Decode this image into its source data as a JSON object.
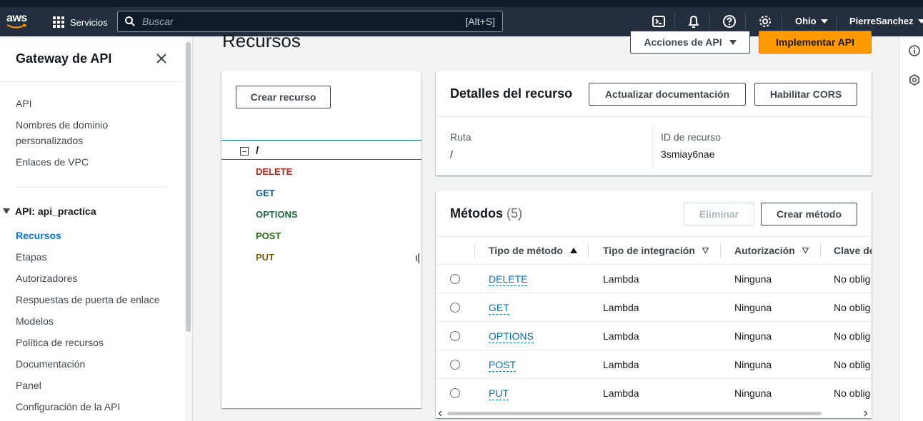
{
  "topbar": {
    "logo": "aws",
    "services_label": "Servicios",
    "search_placeholder": "Buscar",
    "search_shortcut": "[Alt+S]",
    "icons": [
      "cloudshell-icon",
      "bell-icon",
      "help-icon",
      "gear-icon"
    ],
    "region": "Ohio",
    "user": "PierreSanchez"
  },
  "sidebar": {
    "title": "Gateway de API",
    "top_links": [
      "API",
      "Nombres de dominio personalizados",
      "Enlaces de VPC"
    ],
    "section_title": "API: api_practica",
    "section_links": [
      "Recursos",
      "Etapas",
      "Autorizadores",
      "Respuestas de puerta de enlace",
      "Modelos",
      "Política de recursos",
      "Documentación",
      "Panel",
      "Configuración de la API"
    ],
    "active": "Recursos"
  },
  "main": {
    "title": "Recursos",
    "actions_button": "Acciones de API",
    "deploy_button": "Implementar API"
  },
  "resource_tree": {
    "create_button": "Crear recurso",
    "root": "/",
    "methods": [
      {
        "label": "DELETE",
        "color": "#b0281a"
      },
      {
        "label": "GET",
        "color": "#0f5a8c"
      },
      {
        "label": "OPTIONS",
        "color": "#1d6a3f"
      },
      {
        "label": "POST",
        "color": "#2f6f13"
      },
      {
        "label": "PUT",
        "color": "#7a5b0c"
      }
    ]
  },
  "resource_details": {
    "title": "Detalles del recurso",
    "update_docs_button": "Actualizar documentación",
    "cors_button": "Habilitar CORS",
    "path_label": "Ruta",
    "path_value": "/",
    "id_label": "ID de recurso",
    "id_value": "3smiay6nae"
  },
  "methods_panel": {
    "title": "Métodos",
    "count": "(5)",
    "delete_button": "Eliminar",
    "create_button": "Crear método",
    "columns": [
      "Tipo de método",
      "Tipo de integración",
      "Autorización",
      "Clave de"
    ],
    "rows": [
      {
        "method": "DELETE",
        "integration": "Lambda",
        "auth": "Ninguna",
        "key": "No oblig"
      },
      {
        "method": "GET",
        "integration": "Lambda",
        "auth": "Ninguna",
        "key": "No oblig"
      },
      {
        "method": "OPTIONS",
        "integration": "Lambda",
        "auth": "Ninguna",
        "key": "No oblig"
      },
      {
        "method": "POST",
        "integration": "Lambda",
        "auth": "Ninguna",
        "key": "No oblig"
      },
      {
        "method": "PUT",
        "integration": "Lambda",
        "auth": "Ninguna",
        "key": "No oblig"
      }
    ]
  },
  "right_rail": {
    "icons": [
      "info-icon",
      "shield-icon"
    ]
  }
}
